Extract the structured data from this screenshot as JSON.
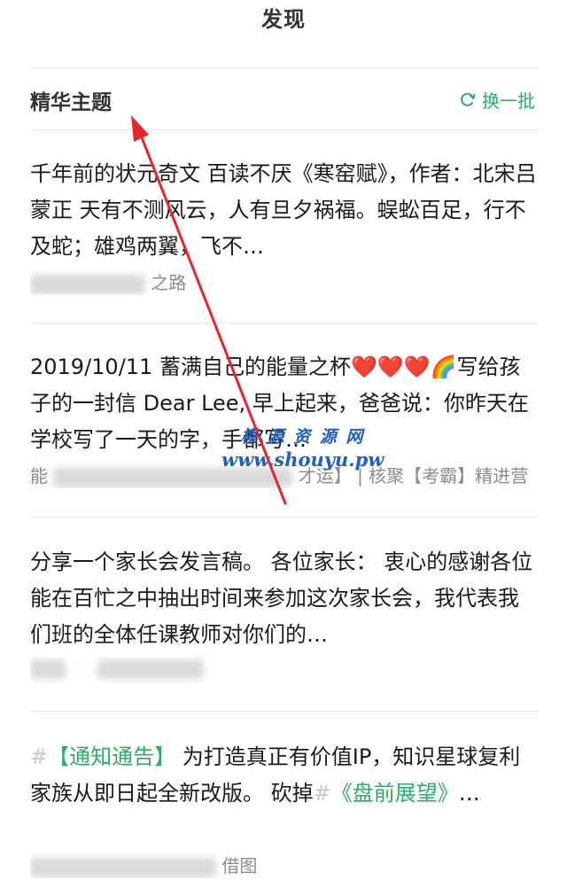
{
  "header": {
    "title": "发现"
  },
  "section": {
    "title": "精华主题",
    "refresh_label": "换一批",
    "accent": "#2aae67"
  },
  "posts": [
    {
      "body": "千年前的状元奇文 百读不厌《寒窑赋》，作者：北宋吕蒙正 天有不测风云，人有旦夕祸福。蜈蚣百足，行不及蛇；雄鸡两翼，飞不…",
      "meta": "之路"
    },
    {
      "body": "2019/10/11 蓄满自己的能量之杯❤️❤️❤️🌈写给孩子的一封信 Dear Lee, 早上起来，爸爸说：你昨天在学校写了一天的字，手都写…",
      "meta_prefix": "能",
      "meta": "才运】 | 核聚【考霸】精进营"
    },
    {
      "body": "分享一个家长会发言稿。 各位家长： 衷心的感谢各位能在百忙之中抽出时间来参加这次家长会，我代表我们班的全体任课教师对你们的…",
      "meta": ""
    },
    {
      "body_hash1": "#",
      "body_tag1": "【通知通告】",
      "body_text": " 为打造真正有价值IP，知识星球复利家族从即日起全新改版。 砍掉",
      "body_hash2": "#",
      "body_tag2": "《盘前展望》",
      "body_end": "…",
      "meta": "借图"
    }
  ],
  "watermark": {
    "line1": "模 源 资 源 网",
    "line2": "www.shouyu.pw"
  },
  "annotation": {
    "arrow_color": "#e8262a"
  }
}
